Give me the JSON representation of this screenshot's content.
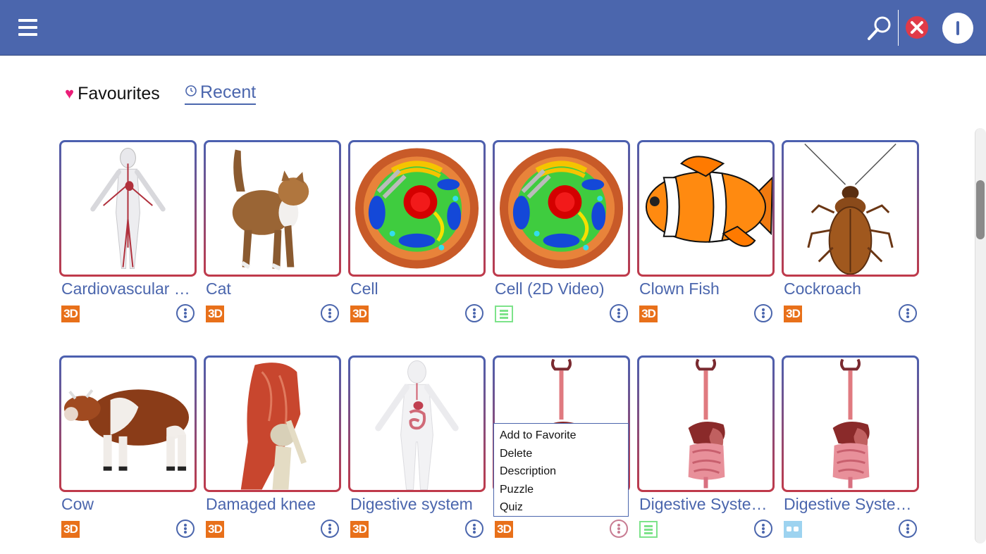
{
  "header": {
    "menu_icon": "hamburger-icon",
    "search_icon": "search-icon",
    "close_icon": "close-x-icon",
    "info_icon": "info-icon",
    "bar_color": "#4b66ad",
    "close_color": "#e03a48"
  },
  "tabs": {
    "favourites": {
      "label": "Favourites",
      "icon": "heart-icon",
      "icon_color": "#ea1e78"
    },
    "recent": {
      "label": "Recent",
      "icon": "clock-icon"
    }
  },
  "items": [
    {
      "title": "Cardiovascular …",
      "badge": "3D",
      "badge_type": "3d",
      "thumb": "cardiovascular"
    },
    {
      "title": "Cat",
      "badge": "3D",
      "badge_type": "3d",
      "thumb": "cat"
    },
    {
      "title": "Cell",
      "badge": "3D",
      "badge_type": "3d",
      "thumb": "cell"
    },
    {
      "title": "Cell (2D Video)",
      "badge": "",
      "badge_type": "video",
      "thumb": "cell"
    },
    {
      "title": "Clown Fish",
      "badge": "3D",
      "badge_type": "3d",
      "thumb": "clownfish"
    },
    {
      "title": "Cockroach",
      "badge": "3D",
      "badge_type": "3d",
      "thumb": "cockroach"
    },
    {
      "title": "Cow",
      "badge": "3D",
      "badge_type": "3d",
      "thumb": "cow"
    },
    {
      "title": "Damaged knee",
      "badge": "3D",
      "badge_type": "3d",
      "thumb": "knee"
    },
    {
      "title": "Digestive system",
      "badge": "3D",
      "badge_type": "3d",
      "thumb": "digestive-body"
    },
    {
      "title": "",
      "badge": "3D",
      "badge_type": "3d",
      "thumb": "digestive"
    },
    {
      "title": "Digestive Syste…",
      "badge": "",
      "badge_type": "video",
      "thumb": "digestive"
    },
    {
      "title": "Digestive Syste…",
      "badge": "",
      "badge_type": "puzzle",
      "thumb": "digestive"
    }
  ],
  "context_menu": {
    "items": [
      "Add to Favorite",
      "Delete",
      "Description",
      "Puzzle",
      "Quiz"
    ]
  },
  "badge_colors": {
    "3d": "#e8701a",
    "video": "#7de38a",
    "puzzle": "#9dd3f0"
  }
}
